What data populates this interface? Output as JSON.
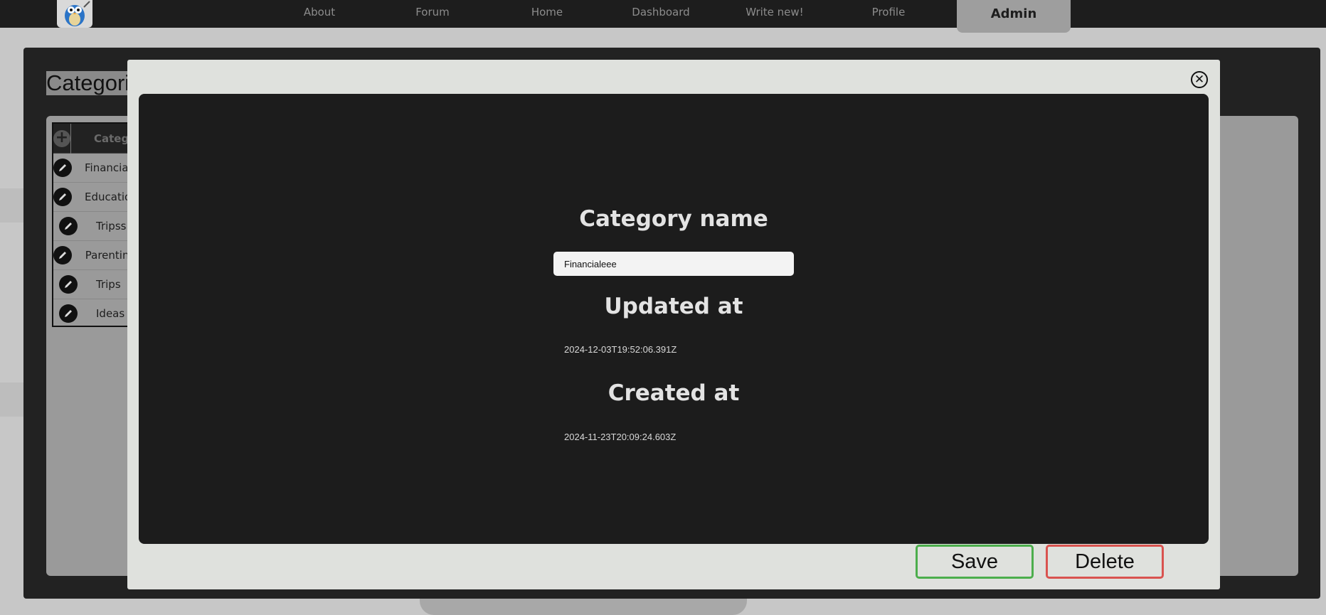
{
  "navbar": {
    "items": [
      {
        "label": "About"
      },
      {
        "label": "Forum"
      },
      {
        "label": "Home"
      },
      {
        "label": "Dashboard"
      },
      {
        "label": "Write new!"
      },
      {
        "label": "Profile"
      },
      {
        "label": "Admin",
        "active": true
      }
    ]
  },
  "page": {
    "title": "Categories",
    "table": {
      "header": "Category",
      "rows": [
        {
          "label": "Financialeee"
        },
        {
          "label": "Education"
        },
        {
          "label": "Tripss"
        },
        {
          "label": "Parenting"
        },
        {
          "label": "Trips"
        },
        {
          "label": "Ideas"
        }
      ]
    }
  },
  "modal": {
    "name_heading": "Category name",
    "name_value": "Financialeee",
    "updated_heading": "Updated at",
    "updated_value": "2024-12-03T19:52:06.391Z",
    "created_heading": "Created at",
    "created_value": "2024-11-23T20:09:24.603Z",
    "save_label": "Save",
    "delete_label": "Delete",
    "close_symbol": "✕"
  },
  "colors": {
    "save_border": "#4cae4c",
    "delete_border": "#d9534f",
    "modal_body": "#1c1c1c",
    "navbar": "#1d1d1d"
  },
  "icons": {
    "logo": "owl-logo",
    "close": "close-icon",
    "add": "add-icon",
    "edit": "pencil-icon"
  }
}
